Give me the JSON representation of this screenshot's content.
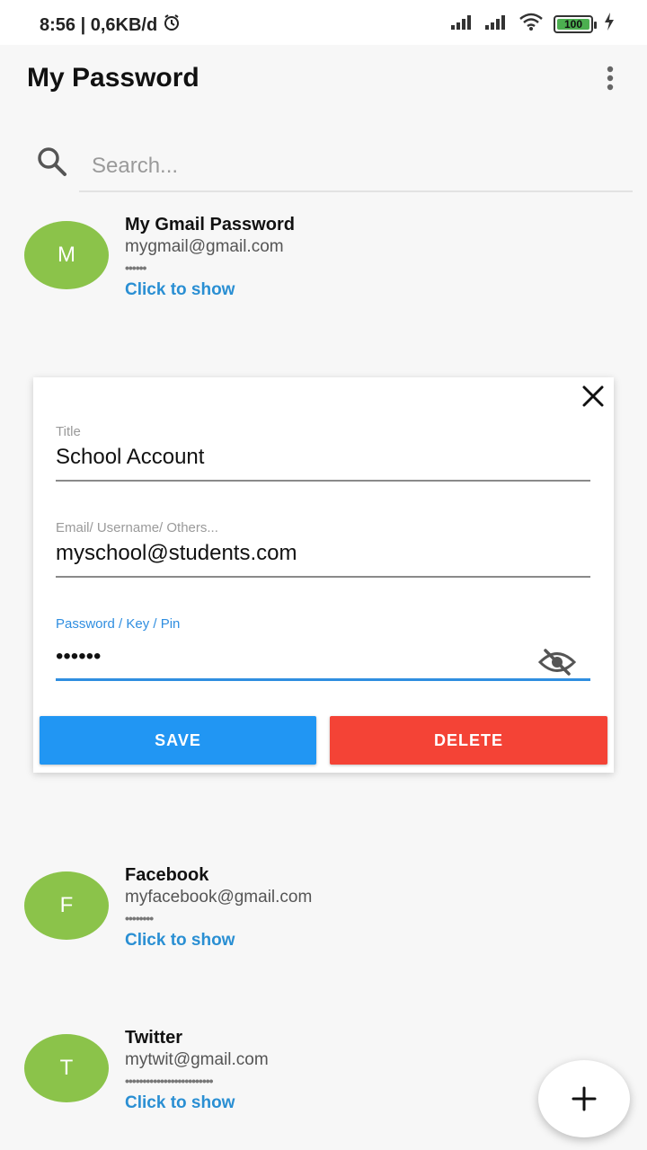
{
  "status_bar": {
    "left_text": "8:56 | 0,6KB/d",
    "battery_percent": "100",
    "icons": [
      "alarm-icon",
      "signal-icon",
      "signal-icon",
      "wifi-icon",
      "battery-icon",
      "charging-icon"
    ]
  },
  "app": {
    "title": "My Password",
    "menu_icon": "more-vert-icon"
  },
  "search": {
    "placeholder": "Search...",
    "value": ""
  },
  "entries": [
    {
      "initial": "M",
      "title": "My Gmail Password",
      "email": "mygmail@gmail.com",
      "masked": "••••••",
      "show_label": "Click to show"
    },
    {
      "initial": "F",
      "title": "Facebook",
      "email": "myfacebook@gmail.com",
      "masked": "••••••••",
      "show_label": "Click to show"
    },
    {
      "initial": "T",
      "title": "Twitter",
      "email": "mytwit@gmail.com",
      "masked": "•••••••••••••••••••••••••",
      "show_label": "Click to show"
    }
  ],
  "dialog": {
    "title_label": "Title",
    "title_value": "School Account",
    "email_label": "Email/ Username/ Others...",
    "email_value": "myschool@students.com",
    "password_label": "Password / Key / Pin",
    "password_value": "••••••",
    "save_label": "SAVE",
    "delete_label": "DELETE"
  },
  "colors": {
    "avatar": "#8bc34a",
    "link": "#2a8fd3",
    "save": "#2196f3",
    "delete": "#f44336",
    "focus": "#2f8ee0"
  }
}
